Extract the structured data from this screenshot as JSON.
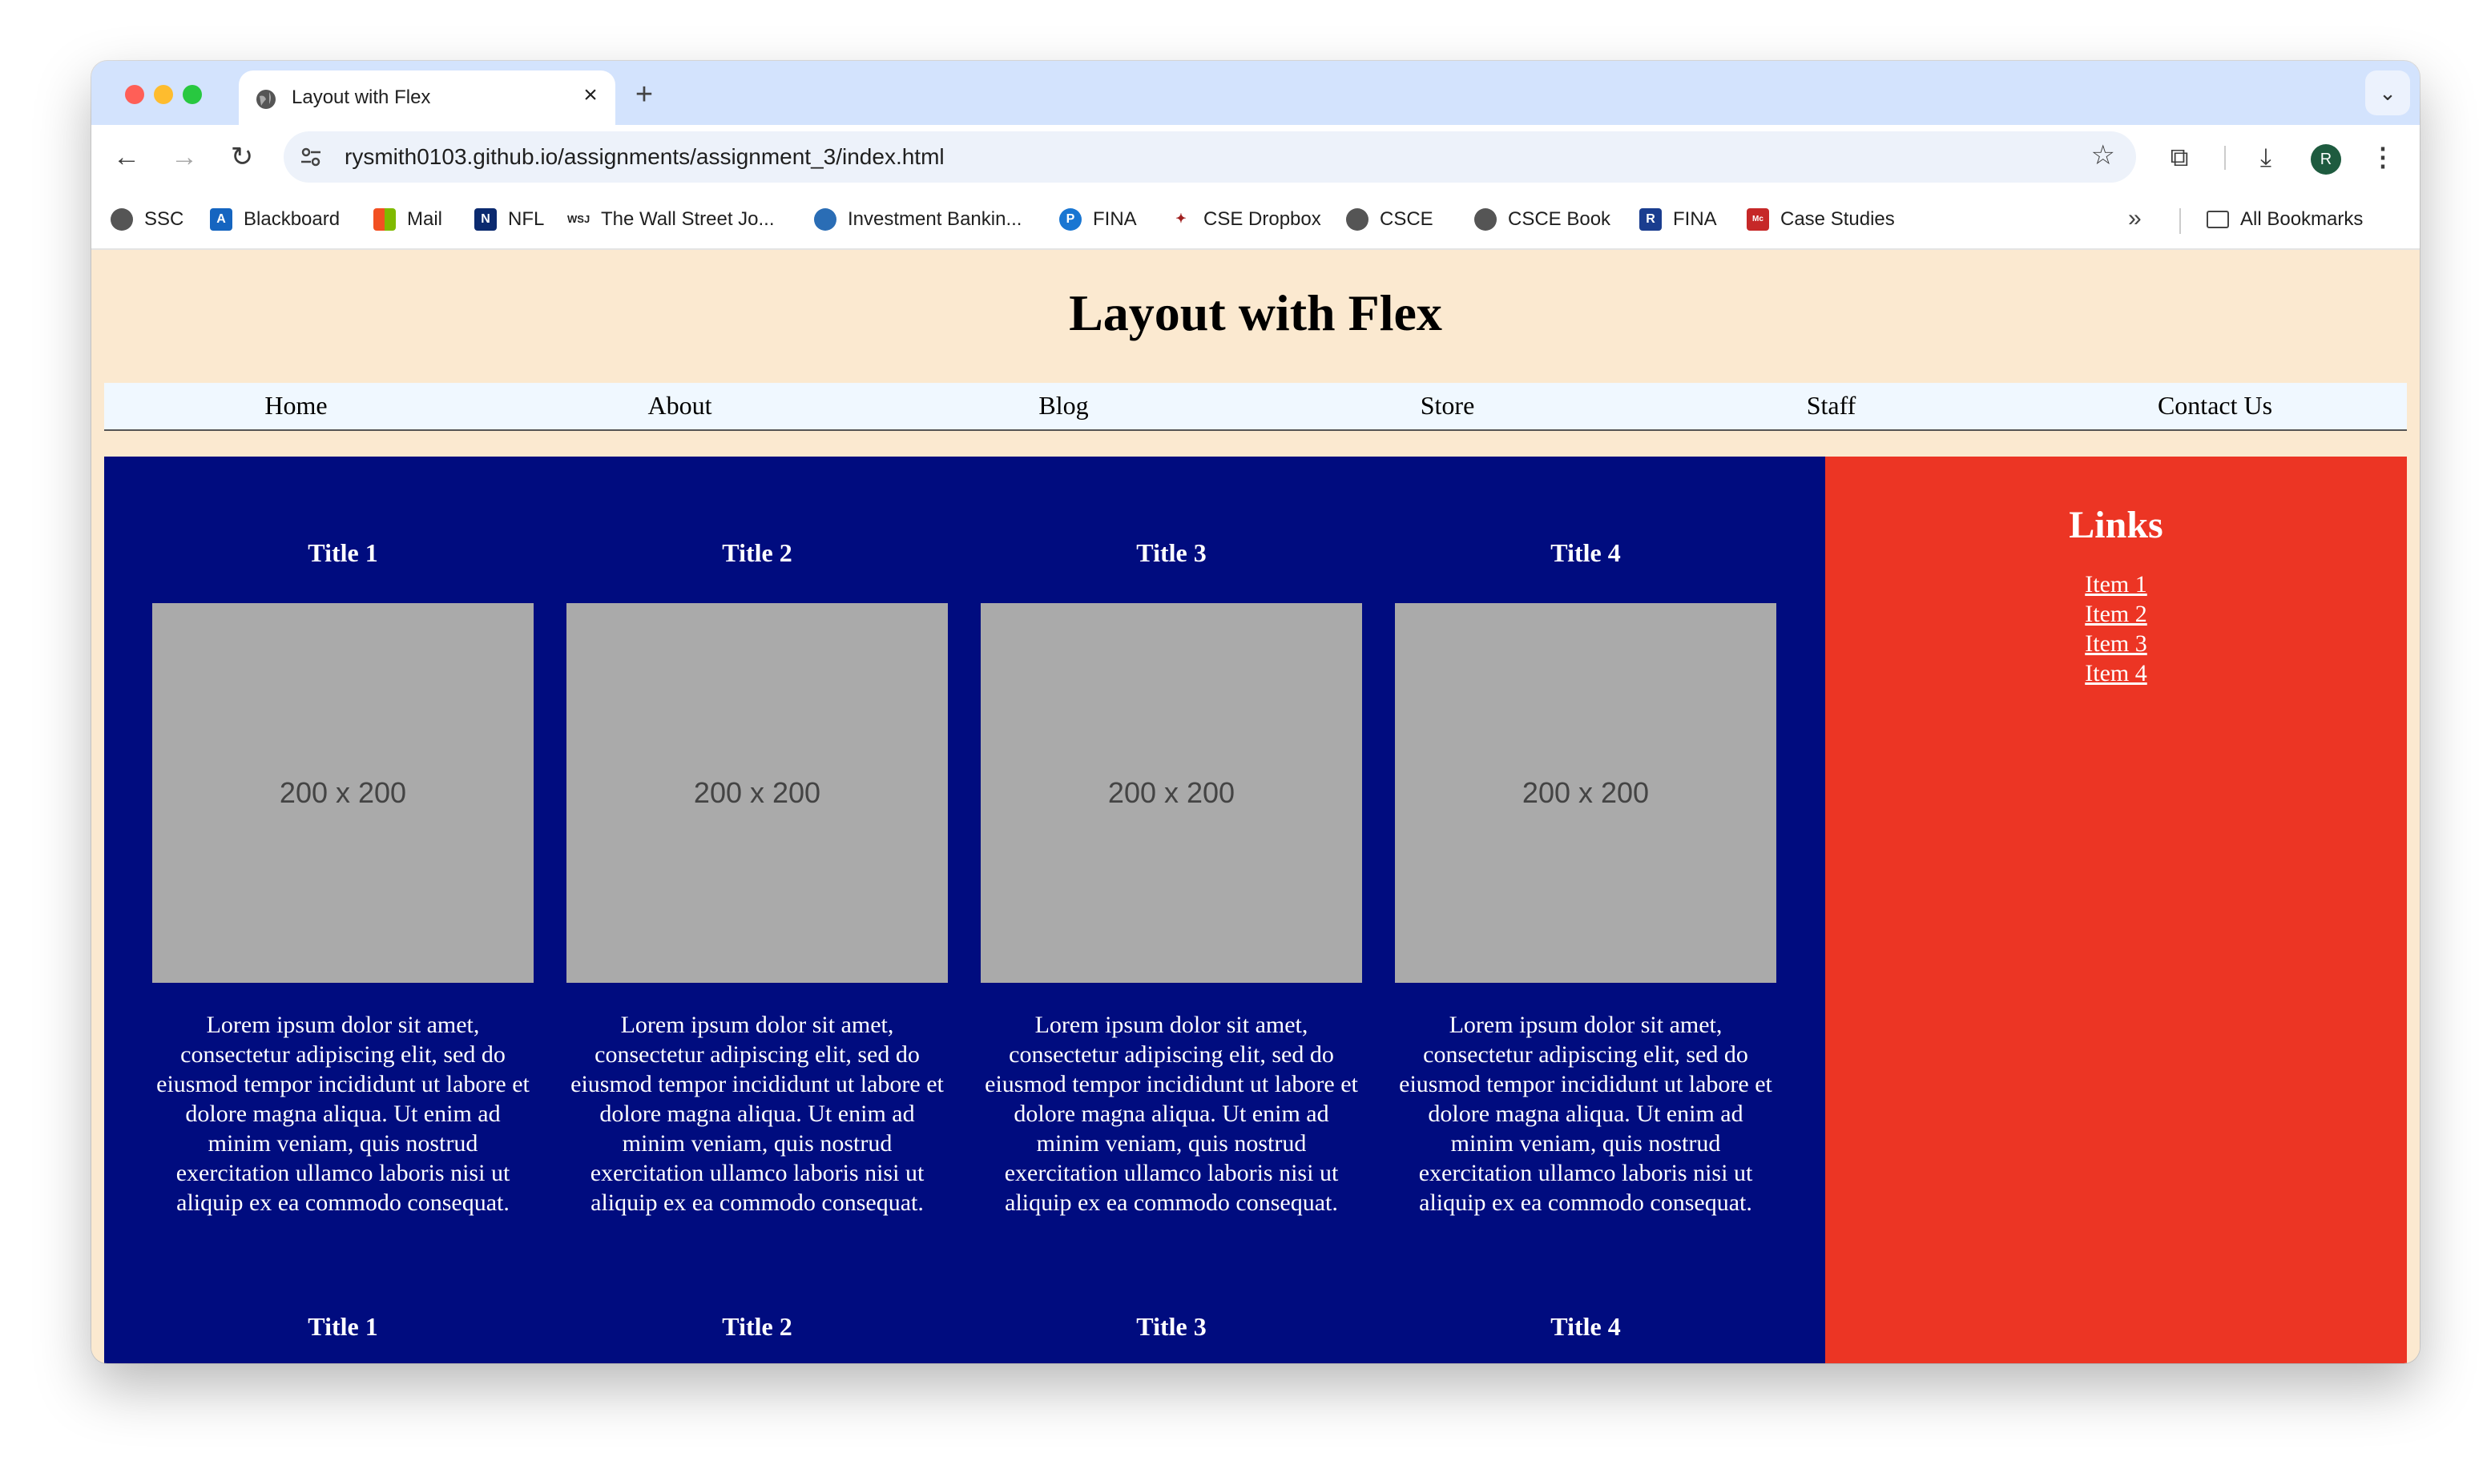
{
  "browser": {
    "tab_title": "Layout with Flex",
    "url": "rysmith0103.github.io/assignments/assignment_3/index.html",
    "avatar_initial": "R",
    "bookmarks": [
      {
        "label": "SSC",
        "icon": "globe-icon"
      },
      {
        "label": "Blackboard",
        "icon": "blackboard-icon"
      },
      {
        "label": "Mail",
        "icon": "microsoft-icon"
      },
      {
        "label": "NFL",
        "icon": "nfl-icon"
      },
      {
        "label": "The Wall Street Jo...",
        "icon": "wsj-icon"
      },
      {
        "label": "Investment Bankin...",
        "icon": "globe-icon"
      },
      {
        "label": "FINA",
        "icon": "p-icon"
      },
      {
        "label": "CSE Dropbox",
        "icon": "figure-icon"
      },
      {
        "label": "CSCE",
        "icon": "globe-icon"
      },
      {
        "label": "CSCE Book",
        "icon": "globe-icon"
      },
      {
        "label": "FINA",
        "icon": "r-icon"
      },
      {
        "label": "Case Studies",
        "icon": "mcgraw-icon"
      }
    ],
    "all_bookmarks": "All Bookmarks"
  },
  "page": {
    "title": "Layout with Flex",
    "nav": [
      "Home",
      "About",
      "Blog",
      "Store",
      "Staff",
      "Contact Us"
    ],
    "cards": [
      {
        "title": "Title 1",
        "image_label": "200 x 200",
        "text": "Lorem ipsum dolor sit amet, consectetur adipiscing elit, sed do eiusmod tempor incididunt ut labore et dolore magna aliqua. Ut enim ad minim veniam, quis nostrud exercitation ullamco laboris nisi ut aliquip ex ea commodo consequat."
      },
      {
        "title": "Title 2",
        "image_label": "200 x 200",
        "text": "Lorem ipsum dolor sit amet, consectetur adipiscing elit, sed do eiusmod tempor incididunt ut labore et dolore magna aliqua. Ut enim ad minim veniam, quis nostrud exercitation ullamco laboris nisi ut aliquip ex ea commodo consequat."
      },
      {
        "title": "Title 3",
        "image_label": "200 x 200",
        "text": "Lorem ipsum dolor sit amet, consectetur adipiscing elit, sed do eiusmod tempor incididunt ut labore et dolore magna aliqua. Ut enim ad minim veniam, quis nostrud exercitation ullamco laboris nisi ut aliquip ex ea commodo consequat."
      },
      {
        "title": "Title 4",
        "image_label": "200 x 200",
        "text": "Lorem ipsum dolor sit amet, consectetur adipiscing elit, sed do eiusmod tempor incididunt ut labore et dolore magna aliqua. Ut enim ad minim veniam, quis nostrud exercitation ullamco laboris nisi ut aliquip ex ea commodo consequat."
      }
    ],
    "second_row_titles": [
      "Title 1",
      "Title 2",
      "Title 3",
      "Title 4"
    ],
    "aside": {
      "title": "Links",
      "items": [
        "Item 1",
        "Item 2",
        "Item 3",
        "Item 4"
      ]
    }
  },
  "colors": {
    "page_bg": "#fbe9d0",
    "nav_bg": "#f0f8ff",
    "content_bg": "#000c7f",
    "aside_bg": "#ec3524",
    "image_placeholder": "#aaaaaa"
  }
}
